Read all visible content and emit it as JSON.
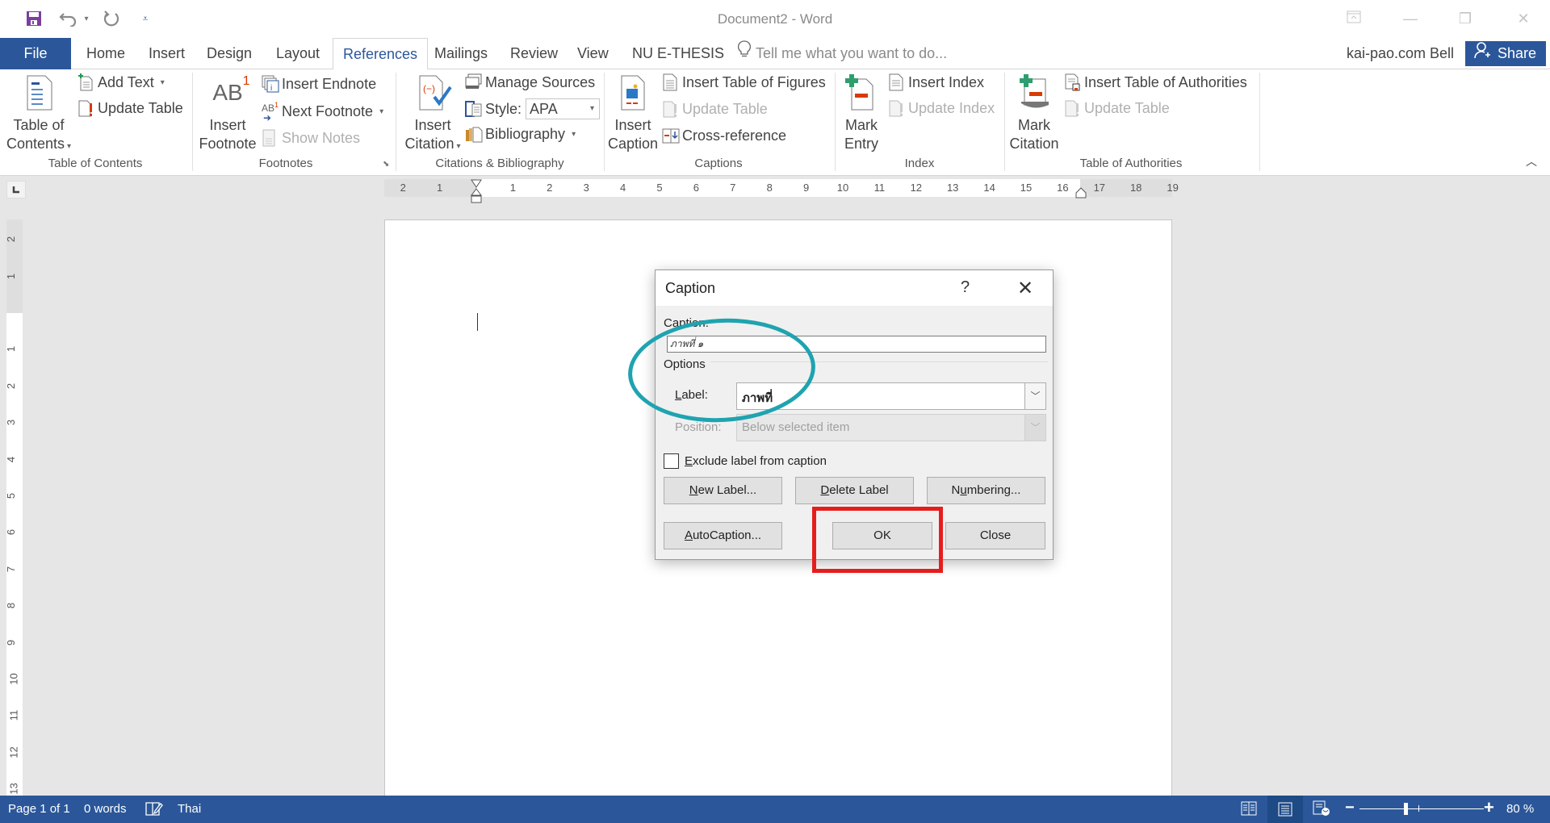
{
  "window": {
    "title": "Document2 - Word",
    "controls": [
      "ribbon-display-options",
      "minimize",
      "restore",
      "close"
    ]
  },
  "qat": {
    "save_icon": "save-icon",
    "undo_icon": "undo-icon",
    "redo_icon": "redo-icon",
    "customize_icon": "customize-qat-icon"
  },
  "tabs": [
    {
      "label": "File"
    },
    {
      "label": "Home"
    },
    {
      "label": "Insert"
    },
    {
      "label": "Design"
    },
    {
      "label": "Layout"
    },
    {
      "label": "References",
      "active": true
    },
    {
      "label": "Mailings"
    },
    {
      "label": "Review"
    },
    {
      "label": "View"
    },
    {
      "label": "NU E-THESIS"
    }
  ],
  "tellme": {
    "placeholder": "Tell me what you want to do..."
  },
  "user": {
    "name": "kai-pao.com Bell",
    "share_label": "Share"
  },
  "ribbon": {
    "toc": {
      "group_label": "Table of Contents",
      "table_of_contents_line1": "Table of",
      "table_of_contents_line2": "Contents",
      "add_text": "Add Text",
      "update_table": "Update Table"
    },
    "footnotes": {
      "group_label": "Footnotes",
      "insert_footnote_line1": "Insert",
      "insert_footnote_line2": "Footnote",
      "insert_endnote": "Insert Endnote",
      "next_footnote": "Next Footnote",
      "show_notes": "Show Notes"
    },
    "citations": {
      "group_label": "Citations & Bibliography",
      "insert_citation_line1": "Insert",
      "insert_citation_line2": "Citation",
      "manage_sources": "Manage Sources",
      "style_label": "Style:",
      "style_value": "APA",
      "bibliography": "Bibliography"
    },
    "captions": {
      "group_label": "Captions",
      "insert_caption_line1": "Insert",
      "insert_caption_line2": "Caption",
      "insert_table_of_figures": "Insert Table of Figures",
      "update_table": "Update Table",
      "cross_reference": "Cross-reference"
    },
    "index": {
      "group_label": "Index",
      "mark_entry_line1": "Mark",
      "mark_entry_line2": "Entry",
      "insert_index": "Insert Index",
      "update_index": "Update Index"
    },
    "authorities": {
      "group_label": "Table of Authorities",
      "mark_citation_line1": "Mark",
      "mark_citation_line2": "Citation",
      "insert_table_of_authorities": "Insert Table of Authorities",
      "update_table": "Update Table"
    }
  },
  "ruler": {
    "horizontal_left_margin": [
      "2",
      "1"
    ],
    "horizontal": [
      "1",
      "2",
      "3",
      "4",
      "5",
      "6",
      "7",
      "8",
      "9",
      "10",
      "11",
      "12",
      "13",
      "14",
      "15",
      "16"
    ],
    "horizontal_right_margin": [
      "17",
      "18",
      "19"
    ],
    "vertical_top_margin": [
      "2",
      "1"
    ],
    "vertical": [
      "1",
      "2",
      "3",
      "4",
      "5",
      "6",
      "7",
      "8",
      "9",
      "10",
      "11",
      "12",
      "13"
    ]
  },
  "dialog": {
    "title": "Caption",
    "help": "?",
    "caption_label": "Caption:",
    "caption_value": "ภาพที่ ๑",
    "options_label": "Options",
    "label_label": "Label:",
    "label_value": "ภาพที่",
    "position_label": "Position:",
    "position_value": "Below selected item",
    "exclude_label": "Exclude label from caption",
    "exclude_checked": false,
    "buttons": {
      "new_label": "New Label...",
      "delete_label": "Delete Label",
      "numbering": "Numbering...",
      "autocaption": "AutoCaption...",
      "ok": "OK",
      "close": "Close"
    }
  },
  "annotations": {
    "highlight_circle_color": "#1fa3b0",
    "highlight_box_color": "#e51d1d"
  },
  "status": {
    "page": "Page 1 of 1",
    "words": "0 words",
    "language": "Thai",
    "zoom": "80 %",
    "zoom_percent": 80
  },
  "colors": {
    "accent": "#2b579a"
  }
}
